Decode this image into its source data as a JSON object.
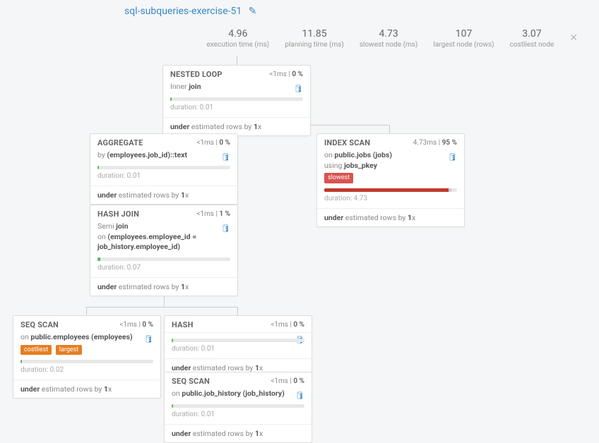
{
  "title": "sql-subqueries-exercise-51",
  "icons": {
    "edit": "✎",
    "db": "🛢",
    "close": "✕"
  },
  "stats": {
    "exec_val": "4.96",
    "exec_lbl": "execution time (ms)",
    "plan_val": "11.85",
    "plan_lbl": "planning time (ms)",
    "slow_val": "4.73",
    "slow_lbl": "slowest node (ms)",
    "large_val": "107",
    "large_lbl": "largest node (rows)",
    "cost_val": "3.07",
    "cost_lbl": "costliest node"
  },
  "nodes": {
    "nl": {
      "name": "NESTED LOOP",
      "ms": "<1ms",
      "pct": "0 %",
      "detail_pre": "Inner ",
      "detail_b": "join",
      "detail_post": "",
      "dur": "duration: 0.01",
      "est_pre": "under",
      "est_mid": " estimated rows by ",
      "est_b": "1",
      "est_post": "x"
    },
    "agg": {
      "name": "AGGREGATE",
      "ms": "<1ms",
      "pct": "0 %",
      "detail_pre": "by ",
      "detail_b": "(employees.job_id)::text",
      "dur": "duration: 0.01",
      "est_pre": "under",
      "est_mid": " estimated rows by ",
      "est_b": "1",
      "est_post": "x"
    },
    "idx": {
      "name": "INDEX SCAN",
      "ms": "4.73ms",
      "pct": "95 %",
      "l1_pre": "on ",
      "l1_b": "public.jobs (jobs)",
      "l2_pre": "using ",
      "l2_b": "jobs_pkey",
      "badge": "slowest",
      "dur": "duration: 4.73",
      "est_pre": "under",
      "est_mid": " estimated rows by ",
      "est_b": "1",
      "est_post": "x"
    },
    "hj": {
      "name": "HASH JOIN",
      "ms": "<1ms",
      "pct": "1 %",
      "l1_pre": "Semi ",
      "l1_b": "join",
      "l2_pre": "on ",
      "l2_b": "(employees.employee_id = job_history.employee_id)",
      "dur": "duration: 0.07",
      "est_pre": "under",
      "est_mid": " estimated rows by ",
      "est_b": "1",
      "est_post": "x"
    },
    "seq1": {
      "name": "SEQ SCAN",
      "ms": "<1ms",
      "pct": "0 %",
      "l1_pre": "on ",
      "l1_b": "public.employees (employees)",
      "badge1": "costliest",
      "badge2": "largest",
      "dur": "duration: 0.02",
      "est_pre": "under",
      "est_mid": " estimated rows by ",
      "est_b": "1",
      "est_post": "x"
    },
    "hash": {
      "name": "HASH",
      "ms": "<1ms",
      "pct": "0 %",
      "dur": "duration: 0.01",
      "est_pre": "under",
      "est_mid": " estimated rows by ",
      "est_b": "1",
      "est_post": "x"
    },
    "seq2": {
      "name": "SEQ SCAN",
      "ms": "<1ms",
      "pct": "0 %",
      "l1_pre": "on ",
      "l1_b": "public.job_history (job_history)",
      "dur": "duration: 0.01",
      "est_pre": "under",
      "est_mid": " estimated rows by ",
      "est_b": "1",
      "est_post": "x"
    }
  }
}
